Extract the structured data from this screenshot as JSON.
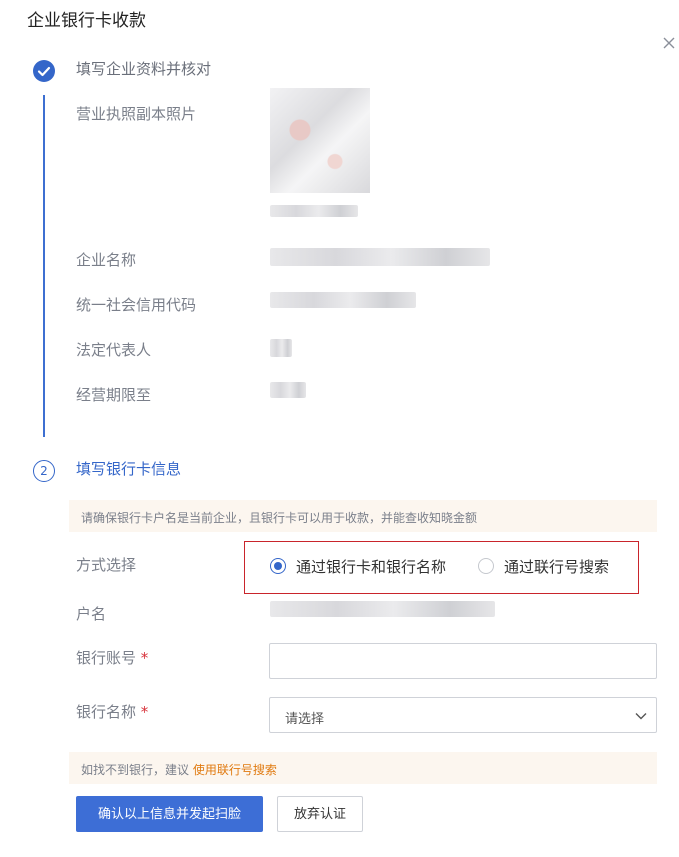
{
  "dialog": {
    "title": "企业银行卡收款"
  },
  "step1": {
    "number": "✓",
    "title": "填写企业资料并核对",
    "fields": {
      "license_label": "营业执照副本照片",
      "company_name_label": "企业名称",
      "credit_code_label": "统一社会信用代码",
      "legal_rep_label": "法定代表人",
      "term_label": "经营期限至"
    }
  },
  "step2": {
    "number": "2",
    "title": "填写银行卡信息",
    "notice": "请确保银行卡户名是当前企业，且银行卡可以用于收款，并能查收知晓金额",
    "method_label": "方式选择",
    "method_options": [
      "通过银行卡和银行名称",
      "通过联行号搜索"
    ],
    "method_selected": "通过银行卡和银行名称",
    "account_name_label": "户名",
    "bank_account_label": "银行账号",
    "bank_account_value": "",
    "bank_name_label": "银行名称",
    "bank_name_placeholder": "请选择",
    "required_mark": "*",
    "hint_text": "如找不到银行，建议",
    "hint_link": "使用联行号搜索"
  },
  "actions": {
    "confirm": "确认以上信息并发起扫脸",
    "abandon": "放弃认证"
  },
  "colors": {
    "primary": "#3466c9",
    "highlight_border": "#c9242b",
    "link": "#e07a10"
  }
}
